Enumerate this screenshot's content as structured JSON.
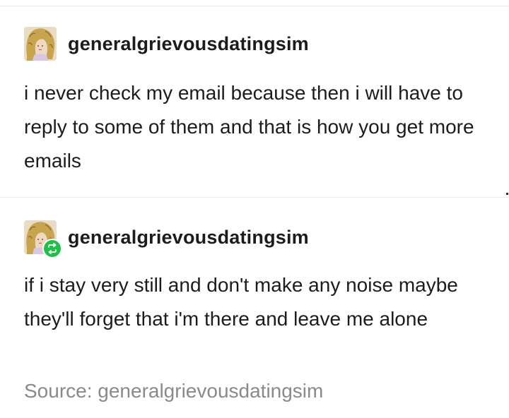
{
  "posts": [
    {
      "username": "generalgrievousdatingsim",
      "avatar_icon": "avatar-curly-hair",
      "text": "i never check my email because then i will have to reply to some of them and that is how you get more emails"
    },
    {
      "username": "generalgrievousdatingsim",
      "avatar_icon": "avatar-curly-hair",
      "badge_icon": "reblog-icon",
      "text": "if i stay very still and don't make any noise maybe they'll forget that i'm there and leave me alone"
    }
  ],
  "source": {
    "label": "Source: generalgrievousdatingsim"
  },
  "colors": {
    "text": "#1c1c1c",
    "muted": "#8a8a8a",
    "reblog_green": "#1fbf4a",
    "divider": "#ececec"
  }
}
